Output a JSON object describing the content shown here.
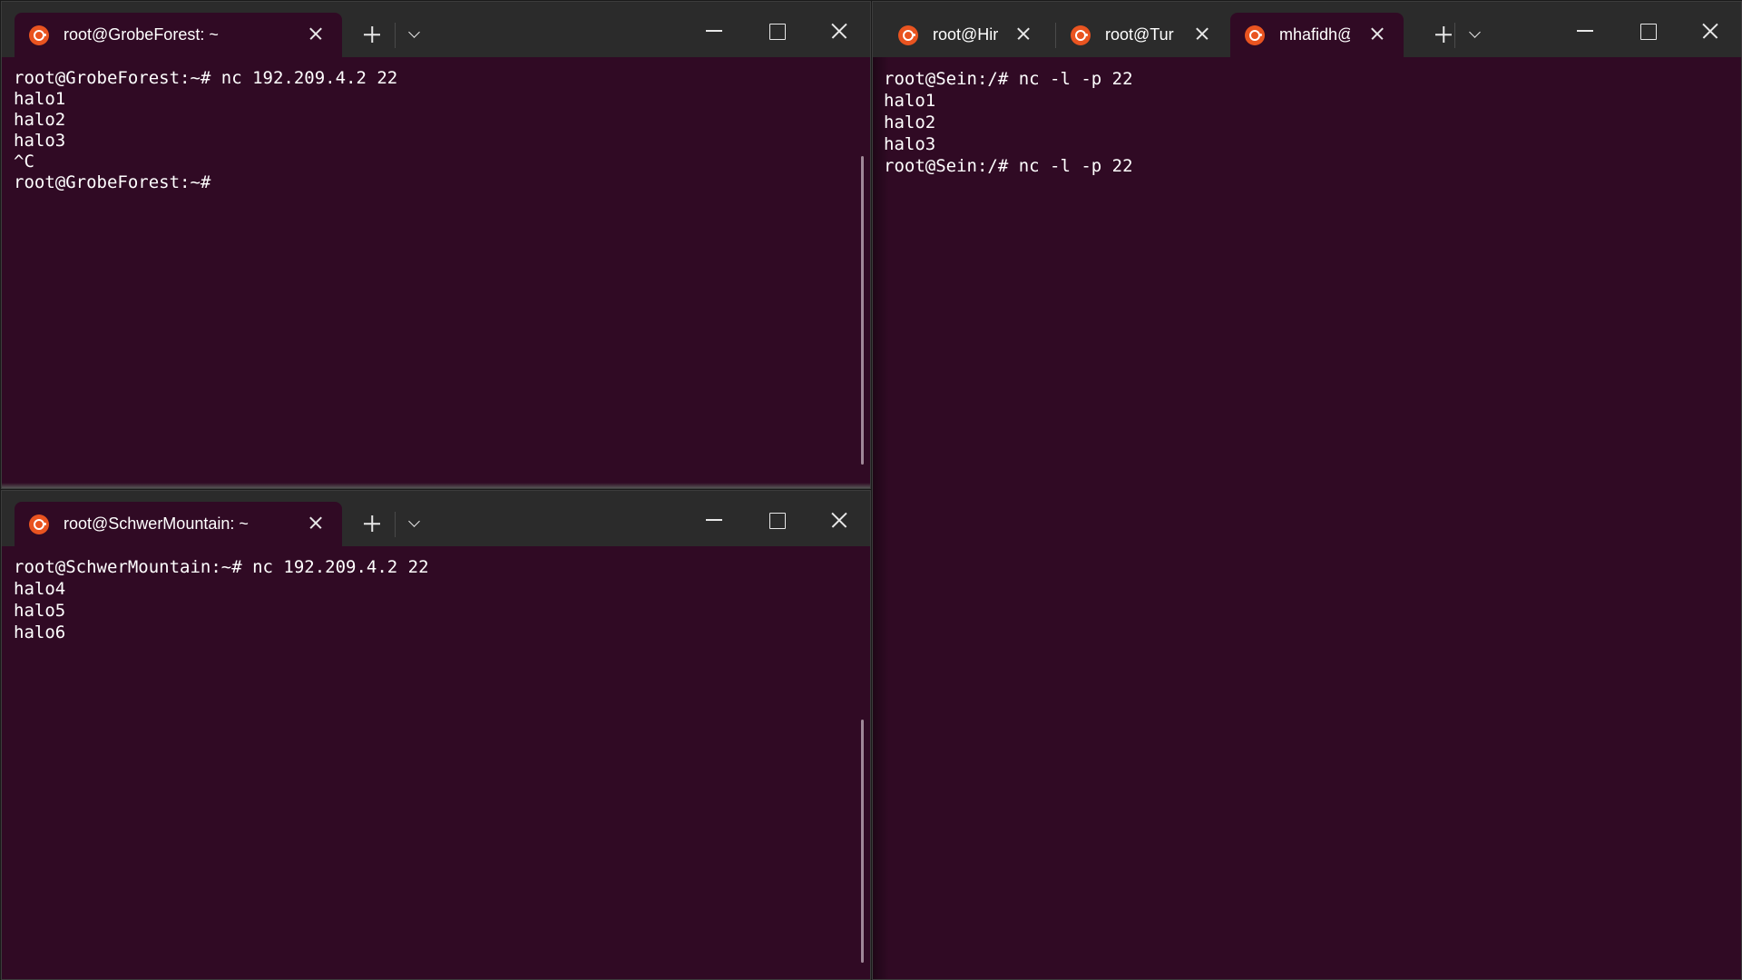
{
  "windows": {
    "top_left": {
      "tabs": [
        {
          "label": "root@GrobeForest: ~"
        }
      ],
      "lines": [
        "root@GrobeForest:~# nc 192.209.4.2 22",
        "halo1",
        "halo2",
        "halo3",
        "^C",
        "root@GrobeForest:~#"
      ]
    },
    "bottom_left": {
      "tabs": [
        {
          "label": "root@SchwerMountain: ~"
        }
      ],
      "lines": [
        "root@SchwerMountain:~# nc 192.209.4.2 22",
        "halo4",
        "halo5",
        "halo6"
      ]
    },
    "right": {
      "tabs": [
        {
          "label": "root@Hir"
        },
        {
          "label": "root@Tur"
        },
        {
          "label": "mhafidh@"
        }
      ],
      "lines": [
        "root@Sein:/# nc -l -p 22",
        "halo1",
        "halo2",
        "halo3",
        "root@Sein:/# nc -l -p 22"
      ]
    }
  },
  "icons": {
    "tab_icon": "ubuntu-logo-icon",
    "new_tab": "plus-icon",
    "tab_menu": "chevron-down-icon",
    "minimize": "minimize-icon",
    "maximize": "maximize-icon",
    "close": "close-icon"
  },
  "colors": {
    "terminal_bg": "#300a24",
    "titlebar_bg": "#2b2b2b",
    "ubuntu_orange": "#e95420",
    "text": "#ffffff"
  }
}
